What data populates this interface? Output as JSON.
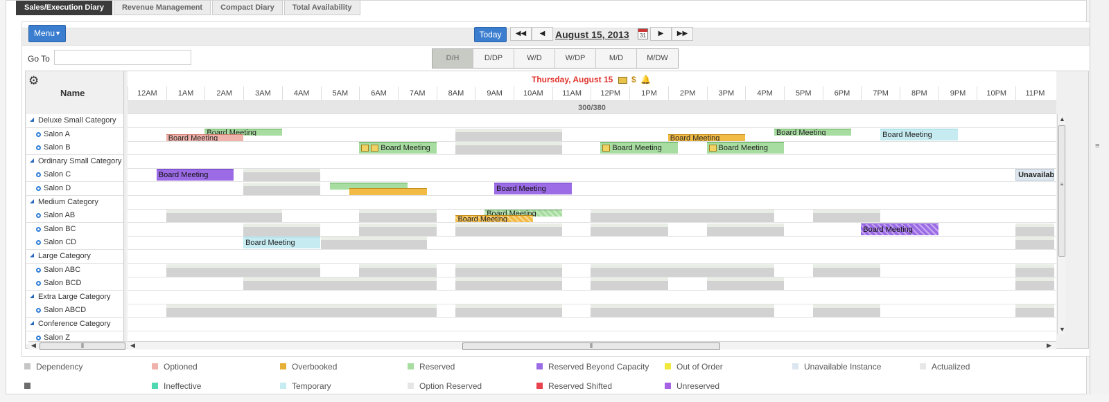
{
  "tabs": [
    "Sales/Execution Diary",
    "Revenue Management",
    "Compact Diary",
    "Total Availability"
  ],
  "toolbar": {
    "menu_label": "Menu",
    "today_label": "Today",
    "date_label": "August 15, 2013",
    "calendar_day": "31",
    "goto_label": "Go To",
    "goto_value": ""
  },
  "views": [
    "D/H",
    "D/DP",
    "W/D",
    "W/DP",
    "M/D",
    "M/DW"
  ],
  "grid": {
    "name_header": "Name",
    "day_header": "Thursday, August 15",
    "capacity": "300/380",
    "hours": [
      "12AM",
      "1AM",
      "2AM",
      "3AM",
      "4AM",
      "5AM",
      "6AM",
      "7AM",
      "8AM",
      "9AM",
      "10AM",
      "11AM",
      "12PM",
      "1PM",
      "2PM",
      "3PM",
      "4PM",
      "5PM",
      "6PM",
      "7PM",
      "8PM",
      "9PM",
      "10PM",
      "11PM"
    ]
  },
  "rows": [
    {
      "label": "Deluxe Small Category",
      "type": "category"
    },
    {
      "label": "Salon A",
      "type": "resource"
    },
    {
      "label": "Salon B",
      "type": "resource"
    },
    {
      "label": "Ordinary Small Category",
      "type": "category"
    },
    {
      "label": "Salon C",
      "type": "resource"
    },
    {
      "label": "Salon D",
      "type": "resource"
    },
    {
      "label": "Medium Category",
      "type": "category"
    },
    {
      "label": "Salon AB",
      "type": "resource"
    },
    {
      "label": "Salon BC",
      "type": "resource"
    },
    {
      "label": "Salon CD",
      "type": "resource"
    },
    {
      "label": "Large Category",
      "type": "category"
    },
    {
      "label": "Salon ABC",
      "type": "resource"
    },
    {
      "label": "Salon BCD",
      "type": "resource"
    },
    {
      "label": "Extra Large Category",
      "type": "category"
    },
    {
      "label": "Salon ABCD",
      "type": "resource"
    },
    {
      "label": "Conference Category",
      "type": "category"
    },
    {
      "label": "Salon Z",
      "type": "resource"
    }
  ],
  "events": [
    {
      "row": 1,
      "start": 2.0,
      "end": 4.0,
      "label": "Board Meeting",
      "status": "reserved",
      "half": "top"
    },
    {
      "row": 1,
      "start": 1.0,
      "end": 3.0,
      "label": "Board Meeting",
      "status": "optioned",
      "half": "bottom"
    },
    {
      "row": 1,
      "start": 14.0,
      "end": 16.0,
      "label": "Board Meeting",
      "status": "overbooked",
      "half": "bottom"
    },
    {
      "row": 1,
      "start": 16.75,
      "end": 18.75,
      "label": "Board Meeting",
      "status": "reserved",
      "half": "top"
    },
    {
      "row": 1,
      "start": 19.5,
      "end": 21.5,
      "label": "Board Meeting",
      "status": "temporary",
      "half": "full"
    },
    {
      "row": 2,
      "start": 6.0,
      "end": 8.0,
      "label": "Board Meeting",
      "status": "reserved",
      "half": "full",
      "icons": 2
    },
    {
      "row": 2,
      "start": 12.25,
      "end": 14.25,
      "label": "Board Meeting",
      "status": "reserved",
      "half": "full",
      "icons": 1
    },
    {
      "row": 2,
      "start": 15.0,
      "end": 17.0,
      "label": "Board Meeting",
      "status": "reserved",
      "half": "full",
      "icons": 1
    },
    {
      "row": 4,
      "start": 0.75,
      "end": 2.75,
      "label": "Board Meeting",
      "status": "beyond",
      "half": "full"
    },
    {
      "row": 4,
      "start": 23.0,
      "end": 24.0,
      "label": "Unavailable",
      "status": "unavailable",
      "half": "full"
    },
    {
      "row": 5,
      "start": 5.25,
      "end": 7.25,
      "label": "",
      "status": "reserved",
      "half": "top"
    },
    {
      "row": 5,
      "start": 5.75,
      "end": 7.75,
      "label": "",
      "status": "overbooked",
      "half": "bottom"
    },
    {
      "row": 5,
      "start": 9.5,
      "end": 11.5,
      "label": "Board Meeting",
      "status": "beyond",
      "half": "full"
    },
    {
      "row": 7,
      "start": 9.25,
      "end": 11.25,
      "label": "Board Meeting",
      "status": "reserved",
      "half": "top",
      "hatch": true
    },
    {
      "row": 7,
      "start": 8.5,
      "end": 10.5,
      "label": "Board Meeting",
      "status": "overbooked",
      "half": "bottom",
      "hatch": true
    },
    {
      "row": 8,
      "start": 19.0,
      "end": 21.0,
      "label": "Board Meeting",
      "status": "beyond",
      "half": "full",
      "hatch": true
    },
    {
      "row": 9,
      "start": 3.0,
      "end": 5.0,
      "label": "Board Meeting",
      "status": "temporary",
      "half": "full"
    }
  ],
  "gray_blocks": [
    {
      "row": 1,
      "start": 8.5,
      "end": 11.25
    },
    {
      "row": 2,
      "start": 8.5,
      "end": 11.25
    },
    {
      "row": 4,
      "start": 3.0,
      "end": 5.0
    },
    {
      "row": 5,
      "start": 3.0,
      "end": 5.0
    },
    {
      "row": 7,
      "start": 1.0,
      "end": 4.0
    },
    {
      "row": 7,
      "start": 6.0,
      "end": 8.0
    },
    {
      "row": 7,
      "start": 12.0,
      "end": 16.75
    },
    {
      "row": 7,
      "start": 17.75,
      "end": 19.5
    },
    {
      "row": 8,
      "start": 3.0,
      "end": 5.0
    },
    {
      "row": 8,
      "start": 6.0,
      "end": 8.0
    },
    {
      "row": 8,
      "start": 8.5,
      "end": 11.25
    },
    {
      "row": 8,
      "start": 12.0,
      "end": 14.0
    },
    {
      "row": 8,
      "start": 15.0,
      "end": 17.0
    },
    {
      "row": 8,
      "start": 23.0,
      "end": 24.0
    },
    {
      "row": 9,
      "start": 5.0,
      "end": 7.75
    },
    {
      "row": 9,
      "start": 23.0,
      "end": 24.0
    },
    {
      "row": 11,
      "start": 1.0,
      "end": 5.0
    },
    {
      "row": 11,
      "start": 6.0,
      "end": 8.0
    },
    {
      "row": 11,
      "start": 8.5,
      "end": 11.25
    },
    {
      "row": 11,
      "start": 12.0,
      "end": 16.75
    },
    {
      "row": 11,
      "start": 17.75,
      "end": 19.5
    },
    {
      "row": 11,
      "start": 23.0,
      "end": 24.0
    },
    {
      "row": 12,
      "start": 3.0,
      "end": 8.0
    },
    {
      "row": 12,
      "start": 8.5,
      "end": 11.25
    },
    {
      "row": 12,
      "start": 12.0,
      "end": 14.0
    },
    {
      "row": 12,
      "start": 15.0,
      "end": 17.0
    },
    {
      "row": 12,
      "start": 23.0,
      "end": 24.0
    },
    {
      "row": 14,
      "start": 1.0,
      "end": 8.0
    },
    {
      "row": 14,
      "start": 8.5,
      "end": 11.25
    },
    {
      "row": 14,
      "start": 12.0,
      "end": 16.75
    },
    {
      "row": 14,
      "start": 17.75,
      "end": 19.5
    },
    {
      "row": 14,
      "start": 23.0,
      "end": 24.0
    }
  ],
  "legend": [
    {
      "label": "Dependency",
      "color": "#c6c6c6"
    },
    {
      "label": "Optioned",
      "color": "#f0b3ab"
    },
    {
      "label": "Overbooked",
      "color": "#e5b035"
    },
    {
      "label": "Reserved",
      "color": "#a7dda0"
    },
    {
      "label": "Reserved Beyond Capacity",
      "color": "#9c6ce6"
    },
    {
      "label": "Out of Order",
      "color": "#f0e83a"
    },
    {
      "label": "Unavailable Instance",
      "color": "#dbe6f0"
    },
    {
      "label": "Actualized",
      "color": "#e8e8e8"
    },
    {
      "label": "",
      "color": "#6d6d6d"
    },
    {
      "label": "Ineffective",
      "color": "#4fd8b2"
    },
    {
      "label": "Temporary",
      "color": "#c6ecf2"
    },
    {
      "label": "Option Reserved",
      "color": "#e6e6e6"
    },
    {
      "label": "Reserved Shifted",
      "color": "#e8434e"
    },
    {
      "label": "Unreserved",
      "color": "#a763e6"
    }
  ]
}
